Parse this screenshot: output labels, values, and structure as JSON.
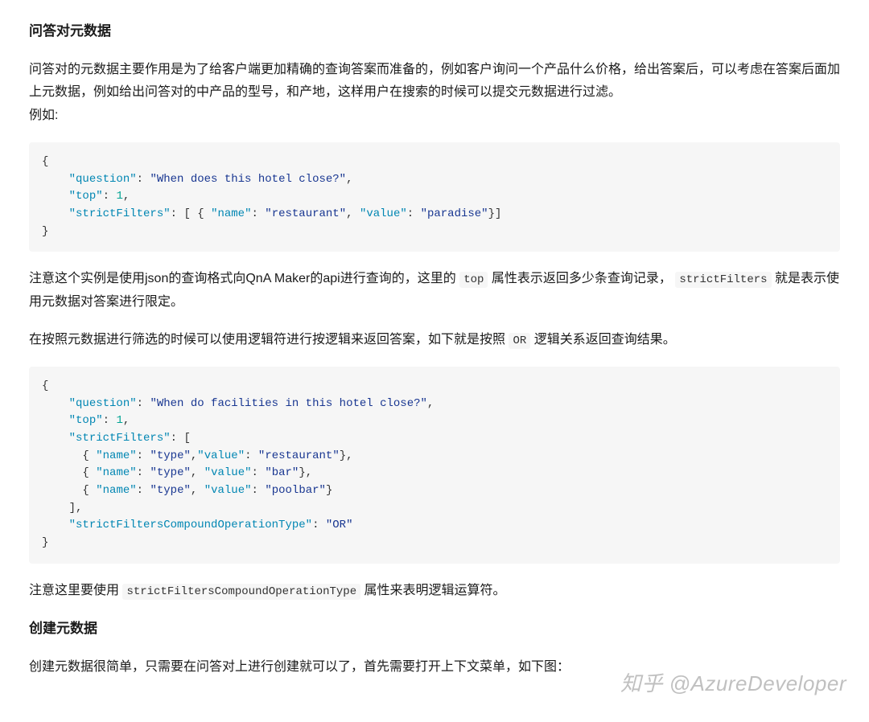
{
  "section1": {
    "heading": "问答对元数据",
    "para1": "问答对的元数据主要作用是为了给客户端更加精确的查询答案而准备的，例如客户询问一个产品什么价格，给出答案后，可以考虑在答案后面加上元数据，例如给出问答对的中产品的型号，和产地，这样用户在搜索的时候可以提交元数据进行过滤。",
    "para1b": "例如:"
  },
  "code1": {
    "key_question": "\"question\"",
    "val_question": "\"When does this hotel close?\"",
    "key_top": "\"top\"",
    "val_top": "1",
    "key_strictFilters": "\"strictFilters\"",
    "key_name": "\"name\"",
    "val_name": "\"restaurant\"",
    "key_value": "\"value\"",
    "val_value": "\"paradise\""
  },
  "para2_pre": "注意这个实例是使用json的查询格式向QnA Maker的api进行查询的，这里的 ",
  "para2_code1": "top",
  "para2_mid": " 属性表示返回多少条查询记录， ",
  "para2_code2": "strictFilters",
  "para2_post": " 就是表示使用元数据对答案进行限定。",
  "para3_pre": "在按照元数据进行筛选的时候可以使用逻辑符进行按逻辑来返回答案，如下就是按照 ",
  "para3_code": "OR",
  "para3_post": " 逻辑关系返回查询结果。",
  "code2": {
    "key_question": "\"question\"",
    "val_question": "\"When do facilities in this hotel close?\"",
    "key_top": "\"top\"",
    "val_top": "1",
    "key_strictFilters": "\"strictFilters\"",
    "key_name": "\"name\"",
    "val_name_type": "\"type\"",
    "key_value": "\"value\"",
    "val_restaurant": "\"restaurant\"",
    "val_bar": "\"bar\"",
    "val_poolbar": "\"poolbar\"",
    "key_compound": "\"strictFiltersCompoundOperationType\"",
    "val_compound": "\"OR\""
  },
  "para4_pre": "注意这里要使用 ",
  "para4_code": "strictFiltersCompoundOperationType",
  "para4_post": " 属性来表明逻辑运算符。",
  "section2": {
    "heading": "创建元数据",
    "para": "创建元数据很简单，只需要在问答对上进行创建就可以了，首先需要打开上下文菜单，如下图："
  },
  "watermark": "知乎 @AzureDeveloper"
}
